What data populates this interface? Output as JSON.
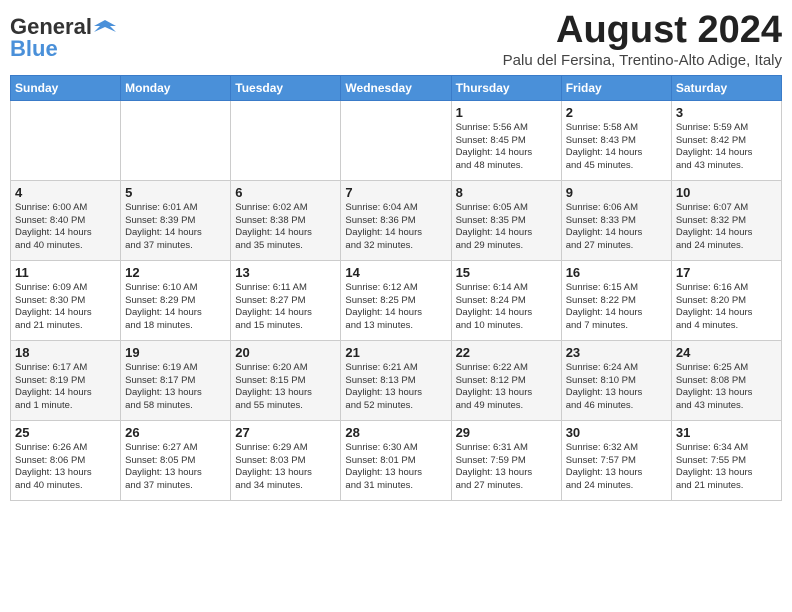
{
  "header": {
    "logo_general": "General",
    "logo_blue": "Blue",
    "month_title": "August 2024",
    "subtitle": "Palu del Fersina, Trentino-Alto Adige, Italy"
  },
  "days_of_week": [
    "Sunday",
    "Monday",
    "Tuesday",
    "Wednesday",
    "Thursday",
    "Friday",
    "Saturday"
  ],
  "weeks": [
    [
      {
        "day": "",
        "info": ""
      },
      {
        "day": "",
        "info": ""
      },
      {
        "day": "",
        "info": ""
      },
      {
        "day": "",
        "info": ""
      },
      {
        "day": "1",
        "info": "Sunrise: 5:56 AM\nSunset: 8:45 PM\nDaylight: 14 hours\nand 48 minutes."
      },
      {
        "day": "2",
        "info": "Sunrise: 5:58 AM\nSunset: 8:43 PM\nDaylight: 14 hours\nand 45 minutes."
      },
      {
        "day": "3",
        "info": "Sunrise: 5:59 AM\nSunset: 8:42 PM\nDaylight: 14 hours\nand 43 minutes."
      }
    ],
    [
      {
        "day": "4",
        "info": "Sunrise: 6:00 AM\nSunset: 8:40 PM\nDaylight: 14 hours\nand 40 minutes."
      },
      {
        "day": "5",
        "info": "Sunrise: 6:01 AM\nSunset: 8:39 PM\nDaylight: 14 hours\nand 37 minutes."
      },
      {
        "day": "6",
        "info": "Sunrise: 6:02 AM\nSunset: 8:38 PM\nDaylight: 14 hours\nand 35 minutes."
      },
      {
        "day": "7",
        "info": "Sunrise: 6:04 AM\nSunset: 8:36 PM\nDaylight: 14 hours\nand 32 minutes."
      },
      {
        "day": "8",
        "info": "Sunrise: 6:05 AM\nSunset: 8:35 PM\nDaylight: 14 hours\nand 29 minutes."
      },
      {
        "day": "9",
        "info": "Sunrise: 6:06 AM\nSunset: 8:33 PM\nDaylight: 14 hours\nand 27 minutes."
      },
      {
        "day": "10",
        "info": "Sunrise: 6:07 AM\nSunset: 8:32 PM\nDaylight: 14 hours\nand 24 minutes."
      }
    ],
    [
      {
        "day": "11",
        "info": "Sunrise: 6:09 AM\nSunset: 8:30 PM\nDaylight: 14 hours\nand 21 minutes."
      },
      {
        "day": "12",
        "info": "Sunrise: 6:10 AM\nSunset: 8:29 PM\nDaylight: 14 hours\nand 18 minutes."
      },
      {
        "day": "13",
        "info": "Sunrise: 6:11 AM\nSunset: 8:27 PM\nDaylight: 14 hours\nand 15 minutes."
      },
      {
        "day": "14",
        "info": "Sunrise: 6:12 AM\nSunset: 8:25 PM\nDaylight: 14 hours\nand 13 minutes."
      },
      {
        "day": "15",
        "info": "Sunrise: 6:14 AM\nSunset: 8:24 PM\nDaylight: 14 hours\nand 10 minutes."
      },
      {
        "day": "16",
        "info": "Sunrise: 6:15 AM\nSunset: 8:22 PM\nDaylight: 14 hours\nand 7 minutes."
      },
      {
        "day": "17",
        "info": "Sunrise: 6:16 AM\nSunset: 8:20 PM\nDaylight: 14 hours\nand 4 minutes."
      }
    ],
    [
      {
        "day": "18",
        "info": "Sunrise: 6:17 AM\nSunset: 8:19 PM\nDaylight: 14 hours\nand 1 minute."
      },
      {
        "day": "19",
        "info": "Sunrise: 6:19 AM\nSunset: 8:17 PM\nDaylight: 13 hours\nand 58 minutes."
      },
      {
        "day": "20",
        "info": "Sunrise: 6:20 AM\nSunset: 8:15 PM\nDaylight: 13 hours\nand 55 minutes."
      },
      {
        "day": "21",
        "info": "Sunrise: 6:21 AM\nSunset: 8:13 PM\nDaylight: 13 hours\nand 52 minutes."
      },
      {
        "day": "22",
        "info": "Sunrise: 6:22 AM\nSunset: 8:12 PM\nDaylight: 13 hours\nand 49 minutes."
      },
      {
        "day": "23",
        "info": "Sunrise: 6:24 AM\nSunset: 8:10 PM\nDaylight: 13 hours\nand 46 minutes."
      },
      {
        "day": "24",
        "info": "Sunrise: 6:25 AM\nSunset: 8:08 PM\nDaylight: 13 hours\nand 43 minutes."
      }
    ],
    [
      {
        "day": "25",
        "info": "Sunrise: 6:26 AM\nSunset: 8:06 PM\nDaylight: 13 hours\nand 40 minutes."
      },
      {
        "day": "26",
        "info": "Sunrise: 6:27 AM\nSunset: 8:05 PM\nDaylight: 13 hours\nand 37 minutes."
      },
      {
        "day": "27",
        "info": "Sunrise: 6:29 AM\nSunset: 8:03 PM\nDaylight: 13 hours\nand 34 minutes."
      },
      {
        "day": "28",
        "info": "Sunrise: 6:30 AM\nSunset: 8:01 PM\nDaylight: 13 hours\nand 31 minutes."
      },
      {
        "day": "29",
        "info": "Sunrise: 6:31 AM\nSunset: 7:59 PM\nDaylight: 13 hours\nand 27 minutes."
      },
      {
        "day": "30",
        "info": "Sunrise: 6:32 AM\nSunset: 7:57 PM\nDaylight: 13 hours\nand 24 minutes."
      },
      {
        "day": "31",
        "info": "Sunrise: 6:34 AM\nSunset: 7:55 PM\nDaylight: 13 hours\nand 21 minutes."
      }
    ]
  ]
}
